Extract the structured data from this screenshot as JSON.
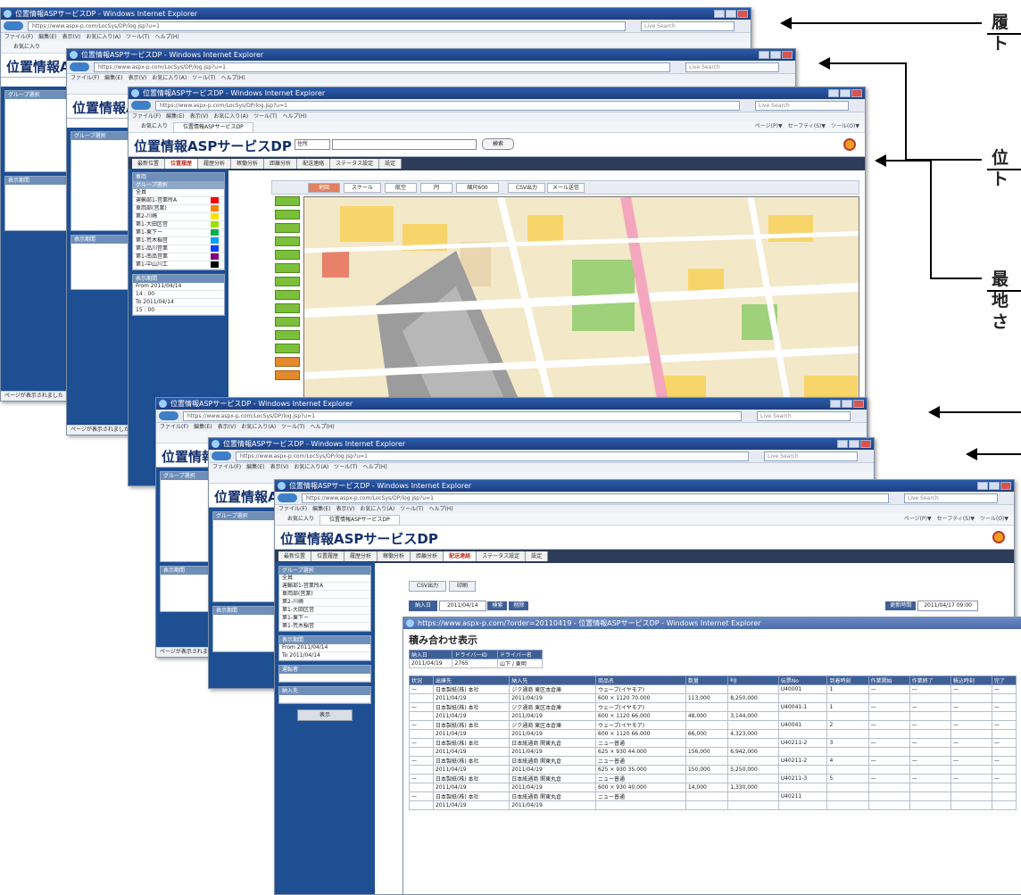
{
  "browser": {
    "title": "位置情報ASPサービスDP - Windows Internet Explorer",
    "url": "https://www.aspx-p.com/LocSys/DP/log.jsp?u=1",
    "search": "Live Search",
    "menu": "ファイル(F)　編集(E)　表示(V)　お気に入り(A)　ツール(T)　ヘルプ(H)",
    "favorites": "お気に入り",
    "tab": "位置情報ASPサービスDP",
    "tools": "ページ(P)▼　セーフティ(S)▼　ツール(O)▼",
    "status": "ページが表示されました"
  },
  "app": {
    "logo": "位置情報ASPサービスDP",
    "header_search_button": "検索",
    "header_search_select": "住所",
    "nav": [
      "最新位置",
      "位置履歴",
      "履歴分析",
      "稼働分析",
      "距離分析",
      "配送連絡",
      "ステータス設定",
      "設定"
    ]
  },
  "sidebar": {
    "panel1_title": "車両",
    "group_header": "グループ選択",
    "vehicles": [
      "全員",
      "運輸部1-営業所A",
      "車両部(営業)",
      "第2-川崎",
      "第1-大田区営",
      "第1-東下ー",
      "第1-荒木稲営",
      "第1-品川営業",
      "第1-南品営業",
      "第1-中山川工"
    ],
    "colors": [
      "#ff0000",
      "#ff8000",
      "#ffe000",
      "#a0e000",
      "#00b050",
      "#00a0ff",
      "#0040ff",
      "#800080",
      "#000000"
    ],
    "period_title": "表示期間",
    "from_label": "From",
    "to_label": "To",
    "from_date": "2011/04/14",
    "to_date": "2011/04/14",
    "time_values": [
      "14",
      "00",
      "15",
      "00"
    ],
    "driver_title": "運転者",
    "place_title": "納入先",
    "display_button": "表示"
  },
  "map_toolbar": {
    "buttons": [
      "地図",
      "スケール",
      "航空",
      "円",
      "縮尺600",
      "CSV出力",
      "メール送信"
    ]
  },
  "delivery": {
    "tabs": [
      "CSV出力",
      "印刷"
    ],
    "date_label": "納入日",
    "date_value": "2011/04/14",
    "btn_search": "検索",
    "btn_clear": "削除",
    "updated_label": "更新時間",
    "updated_value": "2011/04/17 09:00"
  },
  "popup": {
    "title": "https://www.aspx-p.com/?order=20110419 - 位置情報ASPサービスDP - Windows Internet Explorer",
    "heading": "積み合わせ表示",
    "meta_headers": [
      "納入日",
      "ドライバーID",
      "ドライバー名"
    ],
    "meta_values": [
      "2011/04/19",
      "2765",
      "山下 / 東明"
    ],
    "columns": [
      "状況",
      "出庫先",
      "納入先",
      "商品名",
      "数量",
      "kg",
      "伝票No",
      "到着時刻",
      "作業開始",
      "作業終了",
      "積込時刻",
      "完了"
    ],
    "rows": [
      {
        "status": "—",
        "origin": "日本製紙(株) 本社",
        "date": "2011/04/19",
        "dest": "ジク通商 東区本倉庫",
        "product": "ウェーブ(イヤモア)",
        "spec": "600 × 1120 70.000",
        "qty": "113,000",
        "kg": "8,250,000",
        "slip": "U40001",
        "n": "1",
        "dash": "—"
      },
      {
        "status": "—",
        "origin": "日本製紙(株) 本社",
        "date": "2011/04/19",
        "dest": "ジク通商 東区本倉庫",
        "product": "ウェーブ(イヤモア)",
        "spec": "600 × 1120 66.000",
        "qty": "48,000",
        "kg": "3,144,000",
        "slip": "U40041-1",
        "n": "1",
        "dash": "—"
      },
      {
        "status": "—",
        "origin": "日本製紙(株) 本社",
        "date": "2011/04/19",
        "dest": "ジク通商 東区本倉庫",
        "product": "ウェーブ(イヤモア)",
        "spec": "600 × 1120 66.000",
        "qty": "66,000",
        "kg": "4,323,000",
        "slip": "U40041",
        "n": "2",
        "dash": "—"
      },
      {
        "status": "—",
        "origin": "日本製紙(株) 本社",
        "date": "2011/04/19",
        "dest": "日本紙通商 関東丸倉",
        "product": "ニュー普通",
        "spec": "625 × 930 44.000",
        "qty": "156,000",
        "kg": "6,942,000",
        "slip": "U40211-2",
        "n": "3",
        "dash": "—"
      },
      {
        "status": "—",
        "origin": "日本製紙(株) 本社",
        "date": "2011/04/19",
        "dest": "日本紙通商 関東丸倉",
        "product": "ニュー普通",
        "spec": "625 × 930 35.000",
        "qty": "150,000",
        "kg": "5,250,000",
        "slip": "U40211-2",
        "n": "4",
        "dash": "—"
      },
      {
        "status": "—",
        "origin": "日本製紙(株) 本社",
        "date": "2011/04/19",
        "dest": "日本紙通商 関東丸倉",
        "product": "ニュー普通",
        "spec": "600 × 930 40.000",
        "qty": "14,000",
        "kg": "1,330,000",
        "slip": "U40211-3",
        "n": "5",
        "dash": "—"
      },
      {
        "status": "—",
        "origin": "日本製紙(株) 本社",
        "date": "2011/04/19",
        "dest": "日本紙通商 関東丸倉",
        "product": "ニュー普通",
        "spec": "",
        "qty": "",
        "kg": "",
        "slip": "U40211",
        "n": "",
        "dash": ""
      }
    ]
  },
  "callouts": [
    {
      "line1": "履",
      "line2": "ト"
    },
    {
      "line1": "位",
      "line2": "ト"
    },
    {
      "line1": "最",
      "line2": "地",
      "line3": "さ"
    }
  ]
}
